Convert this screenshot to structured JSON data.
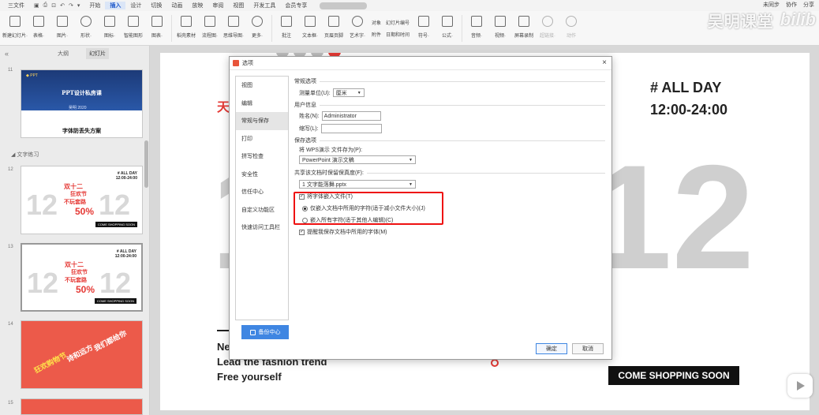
{
  "menubar": {
    "items": [
      "三文件",
      "开始",
      "插入",
      "设计",
      "切换",
      "动画",
      "放映",
      "审阅",
      "视图",
      "开发工具",
      "会员专享"
    ],
    "active": "插入",
    "right": [
      "未同步",
      "协作",
      "分享"
    ]
  },
  "ribbon": {
    "buttons": [
      {
        "label": "新建幻灯片·",
        "icon": "new-slide-icon"
      },
      {
        "label": "表格·",
        "icon": "table-icon"
      },
      {
        "label": "图片·",
        "icon": "image-icon"
      },
      {
        "label": "形状·",
        "icon": "shape-icon"
      },
      {
        "label": "图标·",
        "icon": "icons-icon"
      },
      {
        "label": "智能图形",
        "icon": "smartart-icon"
      },
      {
        "label": "图表·",
        "icon": "chart-icon"
      },
      {
        "label": "稻壳素材",
        "icon": "docer-icon"
      },
      {
        "label": "流程图·",
        "icon": "flowchart-icon"
      },
      {
        "label": "思维导图·",
        "icon": "mindmap-icon"
      },
      {
        "label": "更多·",
        "icon": "more-icon"
      },
      {
        "label": "批注",
        "icon": "comment-icon"
      },
      {
        "label": "文本框·",
        "icon": "textbox-icon"
      },
      {
        "label": "页眉页脚",
        "icon": "header-footer-icon"
      },
      {
        "label": "艺术字·",
        "icon": "wordart-icon"
      }
    ],
    "small_left": [
      "对象",
      "附件"
    ],
    "small_right": [
      "幻灯片编号",
      "日期和时间"
    ],
    "buttons2": [
      {
        "label": "符号·",
        "icon": "symbol-icon"
      },
      {
        "label": "公式·",
        "icon": "formula-icon"
      },
      {
        "label": "音频·",
        "icon": "audio-icon"
      },
      {
        "label": "视频·",
        "icon": "video-icon"
      },
      {
        "label": "屏幕录制",
        "icon": "screen-record-icon"
      },
      {
        "label": "超链接·",
        "icon": "hyperlink-icon",
        "dim": true
      },
      {
        "label": "动作",
        "icon": "action-icon",
        "dim": true
      }
    ]
  },
  "watermark": {
    "text": "吴明课堂"
  },
  "leftpanel": {
    "tabs": [
      "大纲",
      "幻灯片"
    ],
    "selected_tab": "幻灯片",
    "section": "文字练习",
    "thumb11": {
      "num": "11",
      "title": "PPT设计私房课",
      "subtitle": "字体防丢失方案",
      "tag": "吴明 2020"
    },
    "thumb12": {
      "num": "12"
    },
    "thumb13": {
      "num": "13"
    },
    "thumb14": {
      "num": "14"
    },
    "thumb15": {
      "num": "15"
    },
    "slide_thumb": {
      "big_left": "12",
      "big_right": "12",
      "red1": "双十二",
      "red2": "狂欢节",
      "red3": "不玩套路",
      "pct": "50%",
      "day1": "# ALL DAY",
      "day2": "12:00-24:00",
      "soon": "COME SHOPPING SOON"
    },
    "red_thumb": {
      "text1": "狂欢购物节",
      "text2": "诗和远方",
      "text3": "我们都给你"
    }
  },
  "canvas": {
    "red_text": "天猫",
    "allday": "# ALL DAY",
    "time": "12:00-24:00",
    "big_left": "1",
    "big_right": "12",
    "line1": "Ne",
    "line2": "Lead the fashion trend",
    "line3": "Free yourself",
    "soon": "COME SHOPPING SOON"
  },
  "dialog": {
    "title": "选项",
    "nav": [
      "视图",
      "编辑",
      "常规与保存",
      "打印",
      "拼写检查",
      "安全性",
      "信任中心",
      "自定义功能区",
      "快速访问工具栏"
    ],
    "nav_selected": "常规与保存",
    "backup_label": "备份中心",
    "groups": {
      "general": "常规选项",
      "user": "用户信息",
      "save": "保存选项",
      "fidelity": "共享该文档时保留保真度(F):"
    },
    "unit_label": "测量单位(U):",
    "unit_value": "厘米",
    "name_label": "姓名(N):",
    "name_value": "Administrator",
    "initials_label": "缩写(L):",
    "initials_value": "",
    "save_as_label": "将 WPS演示 文件存为(P):",
    "save_as_value": "PowerPoint 演示文稿",
    "doc_value": "1 文字能落舞.pptx",
    "embed_label": "将字体嵌入文件(T)",
    "embed_checked": true,
    "radio1": "仅嵌入文档中所用的字符(适于减小文件大小)(J)",
    "radio2": "嵌入所有字符(适于其他人编辑)(C)",
    "remind_label": "提醒我保存文档中所用的字体(M)",
    "remind_checked": true,
    "ok": "确定",
    "cancel": "取消"
  },
  "colors": {
    "accent": "#3f86e2",
    "highlight": "#e11111",
    "slide_red": "#e53935"
  }
}
